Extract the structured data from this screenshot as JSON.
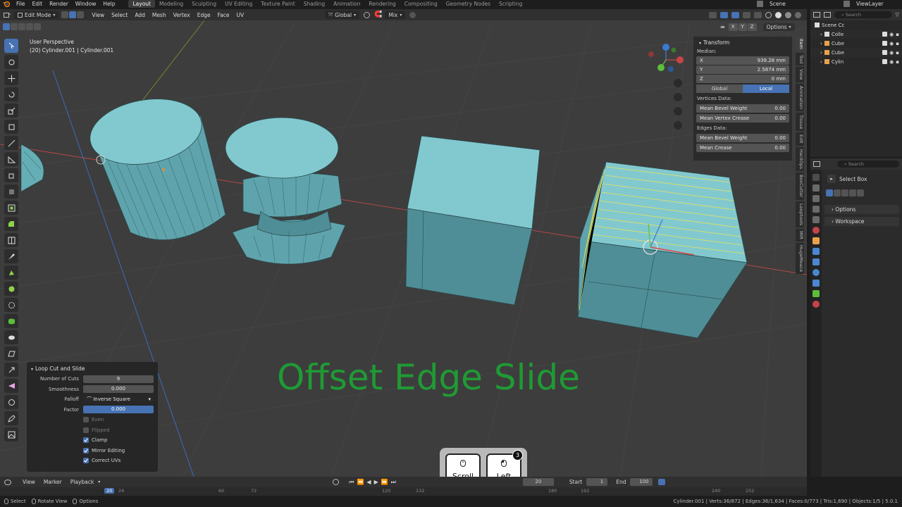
{
  "menu": {
    "items": [
      "File",
      "Edit",
      "Render",
      "Window",
      "Help"
    ],
    "workspaces": [
      "Layout",
      "Modeling",
      "Sculpting",
      "UV Editing",
      "Texture Paint",
      "Shading",
      "Animation",
      "Rendering",
      "Compositing",
      "Geometry Nodes",
      "Scripting"
    ],
    "active_workspace": "Layout",
    "scene": "Scene",
    "view_layer": "ViewLayer"
  },
  "header": {
    "mode": "Edit Mode",
    "menus": [
      "View",
      "Select",
      "Add",
      "Mesh",
      "Vertex",
      "Edge",
      "Face",
      "UV"
    ],
    "orientation": "Global",
    "snap": "Mix",
    "options": "Options",
    "axes": [
      "X",
      "Y",
      "Z"
    ]
  },
  "viewport": {
    "perspective": "User Perspective",
    "object_info": "(20) Cylinder.001 | Cylinder.001",
    "overlay_title": "Offset Edge Slide",
    "overlay_color": "#1f9a34"
  },
  "transform_panel": {
    "title": "Transform",
    "median_label": "Median:",
    "x": {
      "label": "X",
      "value": "939.28 mm"
    },
    "y": {
      "label": "Y",
      "value": "2.5874 mm"
    },
    "z": {
      "label": "Z",
      "value": "0 mm"
    },
    "space_global": "Global",
    "space_local": "Local",
    "vertices_data_label": "Vertices Data:",
    "mean_bevel_weight_v": {
      "label": "Mean Bevel Weight",
      "value": "0.00"
    },
    "mean_vertex_crease": {
      "label": "Mean Vertex Crease",
      "value": "0.00"
    },
    "edges_data_label": "Edges Data:",
    "mean_bevel_weight_e": {
      "label": "Mean Bevel Weight",
      "value": "0.00"
    },
    "mean_crease": {
      "label": "Mean Crease",
      "value": "0.00"
    }
  },
  "side_tabs": [
    "Item",
    "Tool",
    "View",
    "Animation",
    "Tissue",
    "Edit",
    "HardOps",
    "BoxCutter",
    "Looptools",
    "MIR",
    "HugeMeace"
  ],
  "loop_cut_panel": {
    "title": "Loop Cut and Slide",
    "number_of_cuts": {
      "label": "Number of Cuts",
      "value": "9"
    },
    "smoothness": {
      "label": "Smoothness",
      "value": "0.000"
    },
    "falloff": {
      "label": "Falloff",
      "value": "Inverse Square"
    },
    "factor": {
      "label": "Factor",
      "value": "0.000"
    },
    "even": "Even",
    "flipped": "Flipped",
    "clamp": "Clamp",
    "mirror_editing": "Mirror Editing",
    "correct_uvs": "Correct UVs"
  },
  "mouse_keys": {
    "scroll": "Scroll",
    "left": "Left",
    "badge": "3"
  },
  "outliner": {
    "search_placeholder": "Search",
    "rows": [
      "Scene Cc",
      "Colle",
      "Cube",
      "Cube",
      "Cylin"
    ]
  },
  "properties": {
    "search_placeholder": "Search",
    "tool": "Select Box",
    "sections": [
      "Options",
      "Workspace"
    ]
  },
  "timeline": {
    "menus": [
      "View",
      "Marker",
      "Playback"
    ],
    "current_frame": "20",
    "start_label": "Start",
    "start": "1",
    "end_label": "End",
    "end": "100",
    "ruler_marks": [
      "20",
      "24",
      "60",
      "72",
      "120",
      "132",
      "180",
      "192",
      "240",
      "252"
    ]
  },
  "statusbar": {
    "select": "Select",
    "rotate_view": "Rotate View",
    "options": "Options",
    "stats": "Cylinder.001 | Verts:36/872 | Edges:36/1,634 | Faces:0/773 | Tris:1,690 | Objects:1/5 | 5.0.1"
  },
  "colors": {
    "accent": "#4772b3",
    "mesh_face": "#6fb8bf",
    "viewport_bg": "#3d3d3d",
    "edge_highlight": "#e7e35a"
  }
}
